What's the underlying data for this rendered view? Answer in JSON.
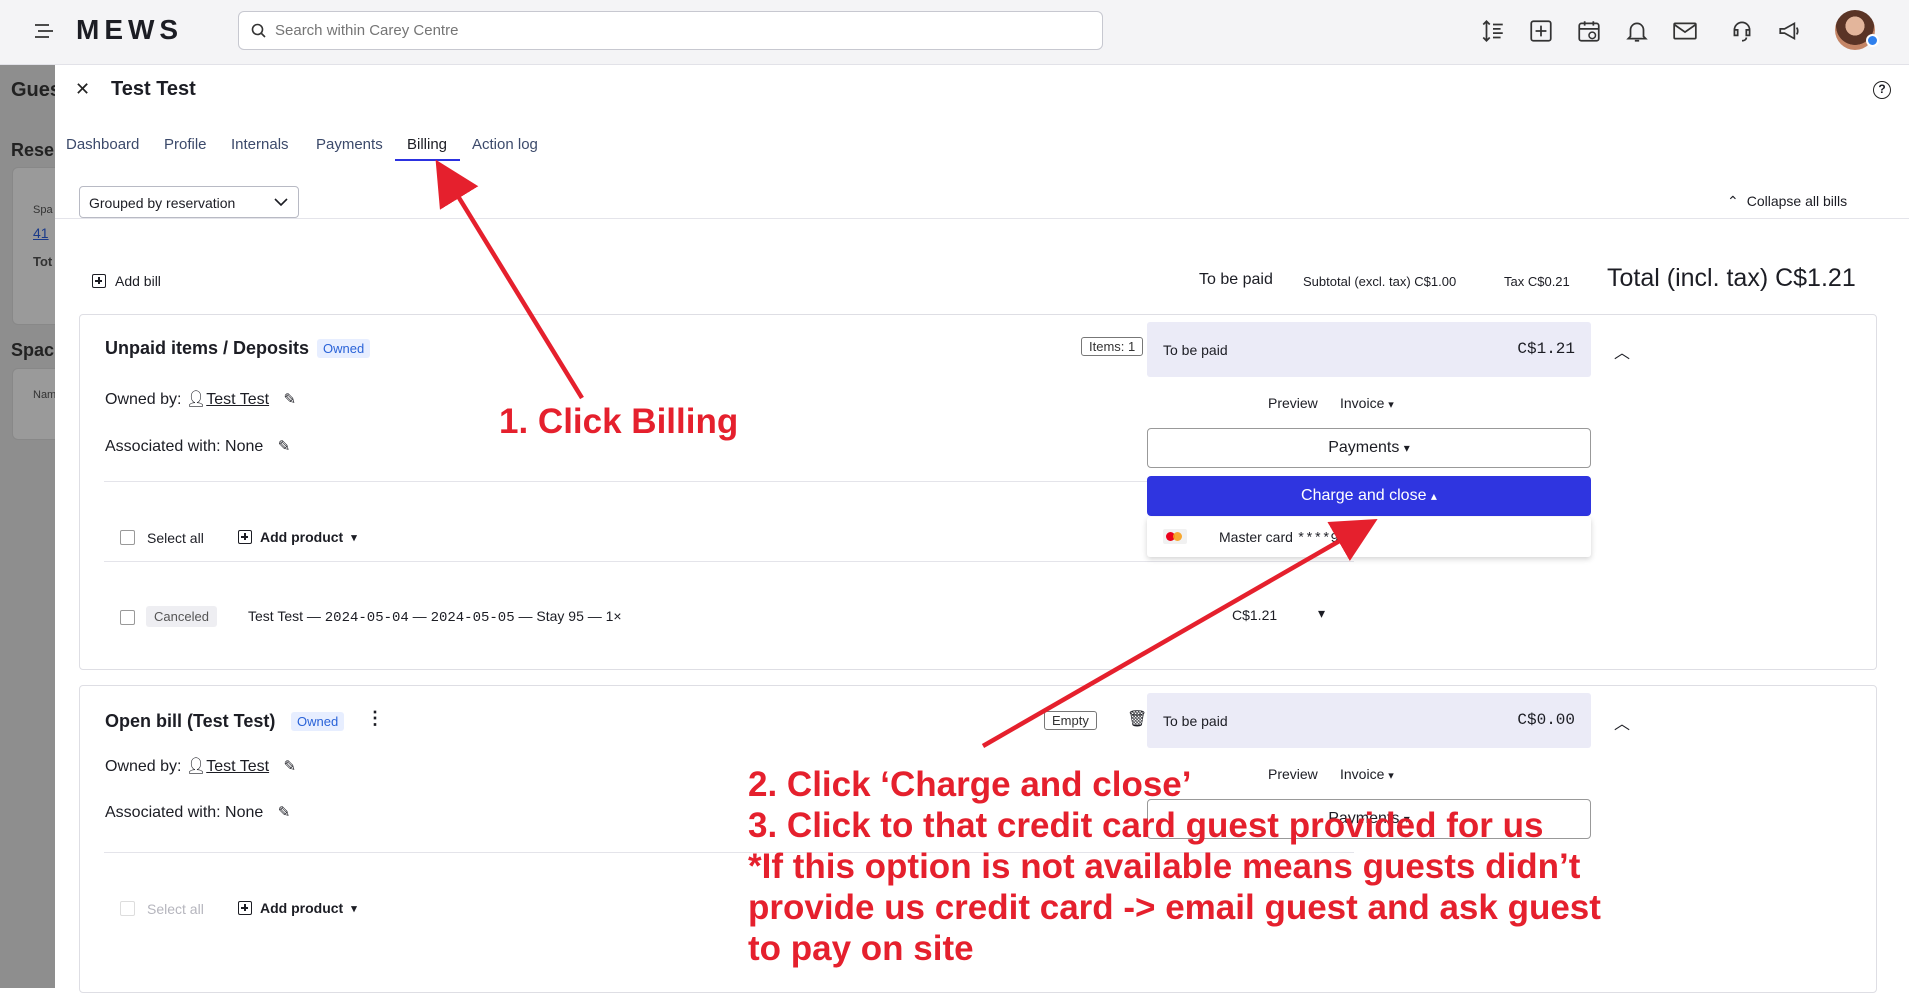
{
  "app": {
    "logo": "MEWS",
    "search_placeholder": "Search within Carey Centre"
  },
  "background": {
    "title_fragment": "Gues",
    "section1": "Rese",
    "col1": "Spa",
    "row1": "41",
    "tot": "Tot",
    "section2": "Spac",
    "name_fragment": "Nam"
  },
  "drawer": {
    "title": "Test Test",
    "tabs": [
      "Dashboard",
      "Profile",
      "Internals",
      "Payments",
      "Billing",
      "Action log"
    ],
    "active_tab": "Billing",
    "group_select": "Grouped by reservation",
    "collapse_all": "Collapse all bills",
    "add_bill": "Add bill",
    "summary": {
      "to_be_paid": "To be paid",
      "subtotal": "Subtotal (excl. tax) C$1.00",
      "tax": "Tax C$0.21",
      "total": "Total (incl. tax) C$1.21"
    }
  },
  "bills": [
    {
      "title": "Unpaid items / Deposits",
      "badge": "Owned",
      "items_badge": "Items: 1",
      "owned_by_label": "Owned by:",
      "owner": "Test Test",
      "associated": "Associated with: None",
      "select_all": "Select all",
      "add_product": "Add product",
      "item": {
        "status": "Canceled",
        "name": "Test Test — ",
        "date_from": "2024-05-04",
        "sep": " — ",
        "date_to": "2024-05-05",
        "rest": " — Stay 95 — 1×",
        "price": "C$1.21"
      },
      "pay_panel": {
        "label": "To be paid",
        "amount": "C$1.21",
        "preview": "Preview",
        "invoice": "Invoice",
        "payments": "Payments",
        "charge": "Charge and close",
        "card_option": {
          "name": "Master card ",
          "number": "****9064"
        }
      }
    },
    {
      "title": "Open bill (Test Test)",
      "badge": "Owned",
      "items_badge": "Empty",
      "owned_by_label": "Owned by:",
      "owner": "Test Test",
      "associated": "Associated with: None",
      "select_all": "Select all",
      "add_product": "Add product",
      "pay_panel": {
        "label": "To be paid",
        "amount": "C$0.00",
        "preview": "Preview",
        "invoice": "Invoice",
        "payments": "Payments"
      }
    }
  ],
  "annotations": {
    "step1": "1. Click Billing",
    "step2": "2. Click ‘Charge and close’",
    "step3": "3. Click to that credit card guest provided for us",
    "note_line1": "*If this option is not available means guests didn’t",
    "note_line2": "provide us credit card -> email guest and ask guest",
    "note_line3": "to pay on site"
  },
  "colors": {
    "primary": "#2f35e0",
    "annotation": "#e5202d",
    "badge_text": "#2a63d8"
  }
}
